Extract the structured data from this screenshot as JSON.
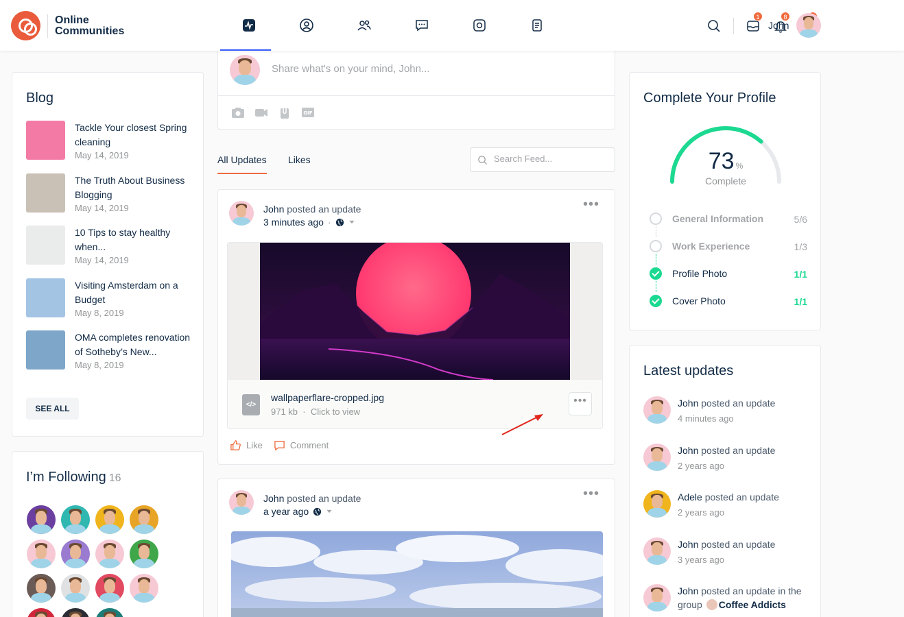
{
  "header": {
    "logo_line1": "Online",
    "logo_line2": "Communities",
    "nav": [
      "activity-icon",
      "profile-icon",
      "members-icon",
      "messages-icon",
      "groups-icon",
      "forums-icon"
    ],
    "badges": {
      "messages": "1",
      "notifications": "8",
      "cart": "3"
    },
    "user_name": "John"
  },
  "blog": {
    "title": "Blog",
    "items": [
      {
        "title": "Tackle Your closest Spring cleaning",
        "date": "May 14, 2019",
        "color": "#f47aa6"
      },
      {
        "title": "The Truth About Business Blogging",
        "date": "May 14, 2019",
        "color": "#c9c1b6"
      },
      {
        "title": "10 Tips to stay healthy when...",
        "date": "May 14, 2019",
        "color": "#e9ecea"
      },
      {
        "title": "Visiting Amsterdam on a Budget",
        "date": "May 8, 2019",
        "color": "#a4c4e4"
      },
      {
        "title": "OMA completes renovation of Sotheby’s New...",
        "date": "May 8, 2019",
        "color": "#7da6c9"
      }
    ],
    "see_all": "SEE ALL"
  },
  "following": {
    "title": "I’m Following",
    "count": "16",
    "avatar_colors": [
      "#6b3fa0",
      "#2fb7b0",
      "#f0b41c",
      "#e8a426",
      "#f6c9d4",
      "#9a7bd0",
      "#f6c9d4",
      "#3fa64a",
      "#6b5b57",
      "#dfe1e3",
      "#e14a61",
      "#f6c9d4",
      "#d2263b",
      "#2c2c34",
      "#1c7d78"
    ]
  },
  "whatsnew": {
    "placeholder": "Share what's on your mind, John..."
  },
  "tabs": {
    "all_updates": "All Updates",
    "likes": "Likes",
    "search_placeholder": "Search Feed..."
  },
  "post1": {
    "author": "John",
    "action": "posted an update",
    "time": "3 minutes ago",
    "file_name": "wallpaperflare-cropped.jpg",
    "file_size": "971 kb",
    "file_action": "Click to view",
    "like": "Like",
    "comment": "Comment"
  },
  "post2": {
    "author": "John",
    "action": "posted an update",
    "time": "a year ago"
  },
  "complete_profile": {
    "title": "Complete Your Profile",
    "percent": 73,
    "percent_text": "73",
    "percent_sign": "%",
    "label": "Complete",
    "steps": [
      {
        "name": "General Information",
        "value": "5/6",
        "done": false
      },
      {
        "name": "Work Experience",
        "value": "1/3",
        "done": false
      },
      {
        "name": "Profile Photo",
        "value": "1/1",
        "done": true
      },
      {
        "name": "Cover Photo",
        "value": "1/1",
        "done": true
      }
    ],
    "accent": "#1cd991"
  },
  "latest": {
    "title": "Latest updates",
    "items": [
      {
        "author": "John",
        "action": "posted an update",
        "time": "4 minutes ago"
      },
      {
        "author": "John",
        "action": "posted an update",
        "time": "2 years ago"
      },
      {
        "author": "Adele",
        "action": "posted an update",
        "time": "2 years ago"
      },
      {
        "author": "John",
        "action": "posted an update",
        "time": "3 years ago"
      },
      {
        "author": "John",
        "action": "posted an update in the group",
        "group": "Coffee Addicts"
      }
    ]
  }
}
